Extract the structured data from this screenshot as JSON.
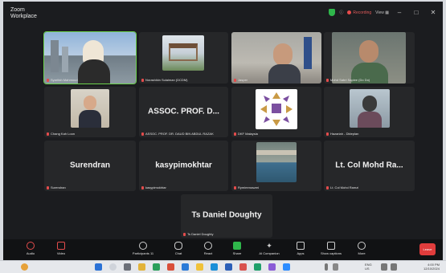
{
  "titlebar": {
    "app_line1": "Zoom",
    "app_line2": "Workplace",
    "recording": "Recording",
    "view": "View",
    "controls": [
      "–",
      "□",
      "✕"
    ]
  },
  "tiles": {
    "t1": {
      "name": "Syarifah Mahmoud"
    },
    "t2": {
      "name": "Norashikin Sulaiman (DCDM)"
    },
    "t3": {
      "name": "Jasper"
    },
    "t4": {
      "name": "Mohd Sabri Sapiee (Do Do)"
    },
    "t5": {
      "name": "Chang Kah Loon"
    },
    "t6": {
      "big": "ASSOC. PROF. D...",
      "name": "ASSOC. PROF. DR. DAUD BIN ABDUL RAZAK"
    },
    "t7": {
      "name": "DKF Malaysia"
    },
    "t8": {
      "name": "Hazariah - Dkteplan"
    },
    "t9": {
      "big": "Surendran",
      "name": "Surendran"
    },
    "t10": {
      "big": "kasypimokhtar",
      "name": "kasypimokhtar"
    },
    "t11": {
      "name": "Rymimmoszmi"
    },
    "t12": {
      "big": "Lt. Col Mohd Ra...",
      "name": "Lt. Col Mohd Ramzi"
    },
    "t13": {
      "big": "Ts Daniel Doughty",
      "name": "Ts Daniel Doughty"
    }
  },
  "toolbar": {
    "audio": "Audio",
    "video": "Video",
    "participants": "Participants",
    "participants_count": "11",
    "chat": "Chat",
    "react": "React",
    "share": "Share",
    "ai": "AI Companion",
    "apps": "Apps",
    "captions": "Show captions",
    "more": "More",
    "leave": "Leave"
  },
  "taskbar": {
    "lang": "ENG\nUS",
    "time": "4:00 PM",
    "date": "12/10/2024"
  },
  "colors": {
    "background": "#1b1c1f",
    "tile": "#262729",
    "active_border": "#6bd14b",
    "leave": "#e03c3c"
  }
}
